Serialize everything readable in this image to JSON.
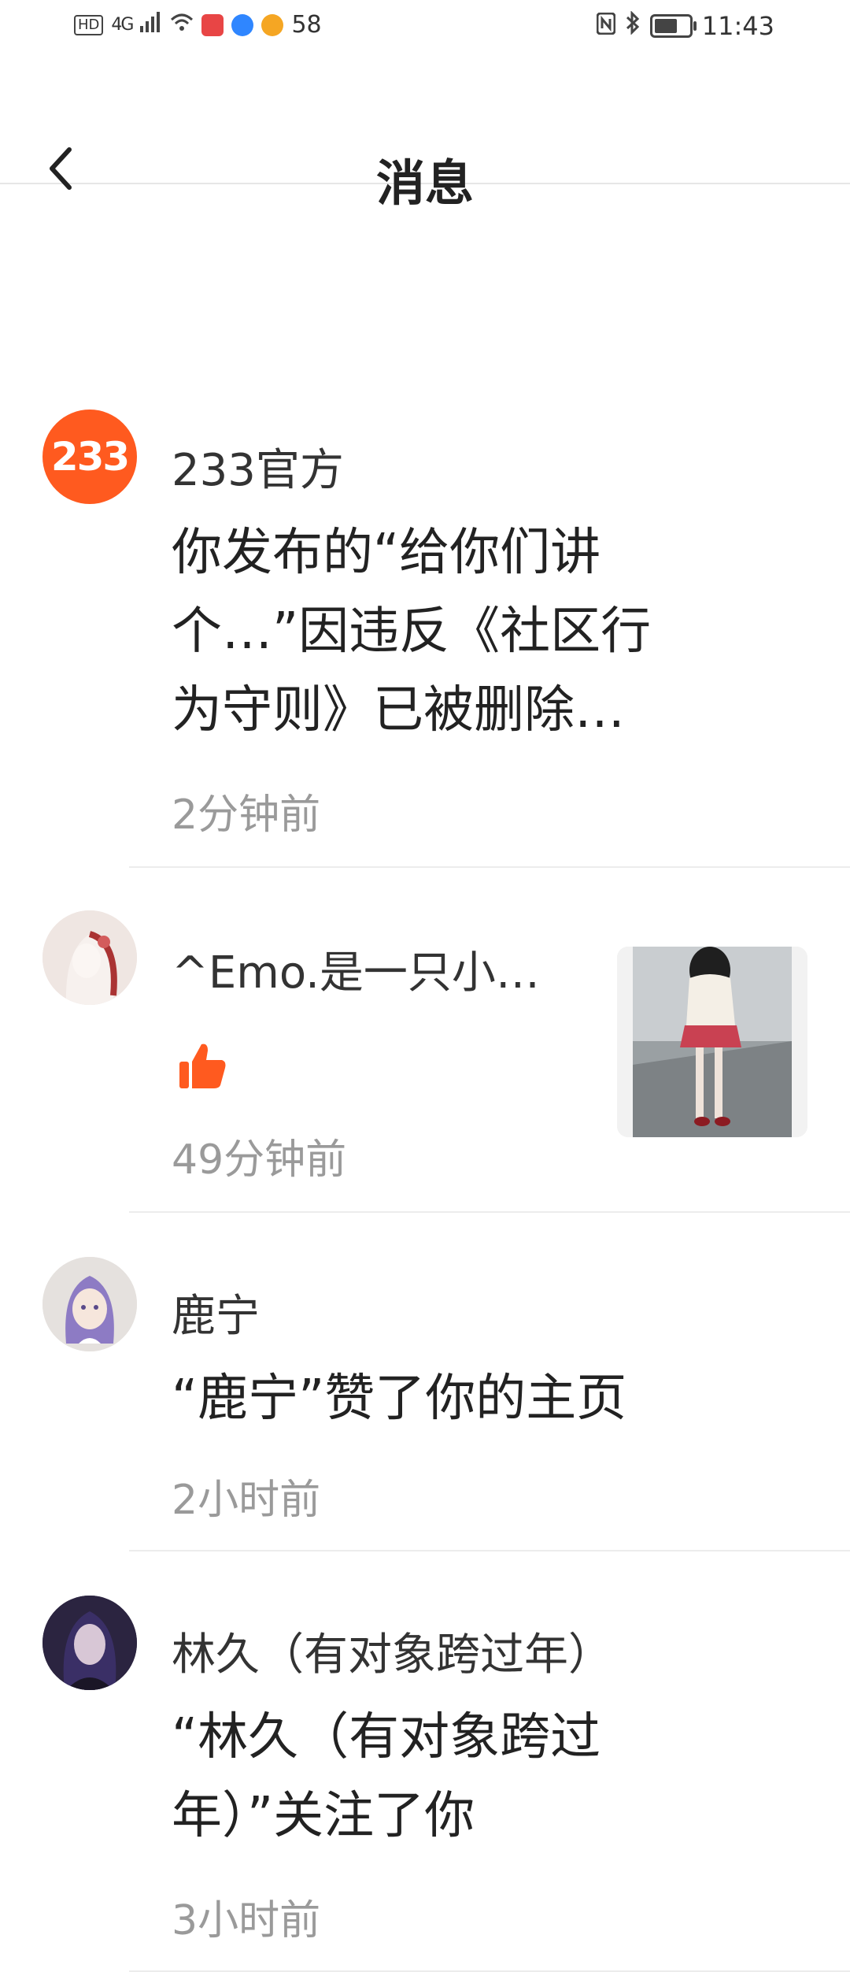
{
  "status_bar": {
    "hd_label": "HD",
    "network_label": "4G",
    "weibo_count": "58",
    "time": "11:43"
  },
  "header": {
    "title": "消息"
  },
  "messages": [
    {
      "name": "233官方",
      "avatar_text": "233",
      "content_lines": [
        "你发布的“给你们讲",
        "个…”因违反《社区行",
        "为守则》已被删除…"
      ],
      "time": "2分钟前"
    },
    {
      "name": "^Emo.是一只小…",
      "type_icon": "thumbs-up-icon",
      "time": "49分钟前"
    },
    {
      "name": "鹿宁",
      "content_lines": [
        "“鹿宁”赞了你的主页"
      ],
      "time": "2小时前"
    },
    {
      "name": "林久（有对象跨过年）",
      "content_lines": [
        "“林久（有对象跨过",
        "年）”关注了你"
      ],
      "time": "3小时前"
    }
  ],
  "colors": {
    "accent": "#ff5a1f",
    "divider": "#ececec",
    "time_text": "#9a9a9a"
  }
}
